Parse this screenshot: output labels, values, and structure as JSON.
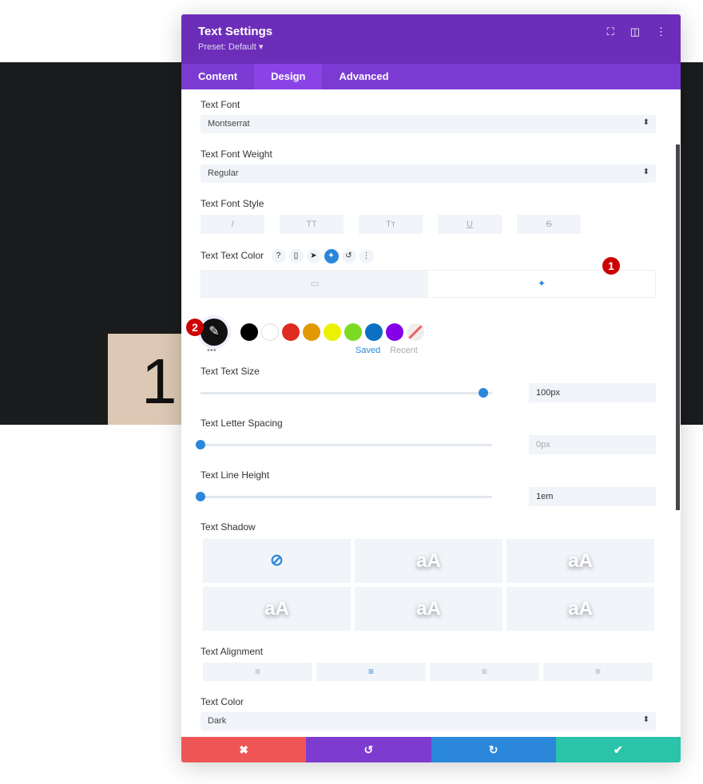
{
  "background": {
    "big_number": "1"
  },
  "modal": {
    "title": "Text Settings",
    "preset": "Preset: Default ▾",
    "tabs": [
      "Content",
      "Design",
      "Advanced"
    ],
    "text_font": {
      "label": "Text Font",
      "value": "Montserrat"
    },
    "text_font_weight": {
      "label": "Text Font Weight",
      "value": "Regular"
    },
    "text_font_style": {
      "label": "Text Font Style",
      "buttons": [
        "I",
        "TT",
        "Tт",
        "U",
        "S"
      ]
    },
    "text_text_color": {
      "label": "Text Text Color",
      "icons": [
        "?",
        "▯",
        "➤",
        "📌",
        "↺",
        "⋮"
      ],
      "swatches": [
        "#000000",
        "#ffffff",
        "#e02b20",
        "#e09900",
        "#edf000",
        "#7cda24",
        "#0c71c3",
        "#8300e9"
      ],
      "saved": "Saved",
      "recent": "Recent",
      "badge1": "1",
      "badge2": "2"
    },
    "text_size": {
      "label": "Text Text Size",
      "value": "100px",
      "percent": 97
    },
    "letter_spacing": {
      "label": "Text Letter Spacing",
      "value": "0px",
      "percent": 0
    },
    "line_height": {
      "label": "Text Line Height",
      "value": "1em",
      "percent": 0
    },
    "text_shadow": {
      "label": "Text Shadow",
      "option": "aA"
    },
    "text_alignment": {
      "label": "Text Alignment"
    },
    "text_color": {
      "label": "Text Color",
      "value": "Dark"
    }
  },
  "colors": {
    "header": "#6c2eb9",
    "tabs": "#7b3bd3",
    "accent": "#2b87da",
    "cancel": "#ef5555",
    "undo": "#7e3bd0",
    "redo": "#2b87da",
    "save": "#29c4a9"
  }
}
